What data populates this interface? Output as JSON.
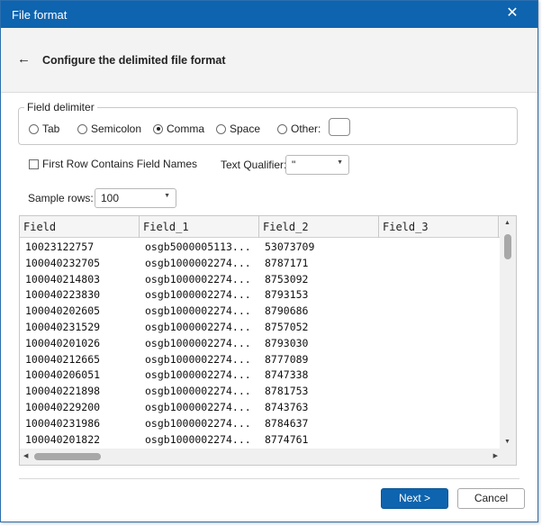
{
  "window": {
    "title": "File format"
  },
  "header": {
    "title": "Configure the delimited file format"
  },
  "delimiter": {
    "legend": "Field delimiter",
    "options": [
      {
        "label": "Tab",
        "checked": false
      },
      {
        "label": "Semicolon",
        "checked": false
      },
      {
        "label": "Comma",
        "checked": true
      },
      {
        "label": "Space",
        "checked": false
      },
      {
        "label": "Other:",
        "checked": false
      }
    ],
    "other_value": ""
  },
  "first_row": {
    "label": "First Row Contains Field Names",
    "checked": false
  },
  "text_qualifier": {
    "label": "Text Qualifier:",
    "value": "\""
  },
  "sample_rows": {
    "label": "Sample rows:",
    "value": "100"
  },
  "grid": {
    "columns": [
      "Field",
      "Field_1",
      "Field_2",
      "Field_3"
    ],
    "rows": [
      [
        "10023122757",
        "osgb5000005113...",
        "53073709",
        ""
      ],
      [
        "100040232705",
        "osgb1000002274...",
        "8787171",
        ""
      ],
      [
        "100040214803",
        "osgb1000002274...",
        "8753092",
        ""
      ],
      [
        "100040223830",
        "osgb1000002274...",
        "8793153",
        ""
      ],
      [
        "100040202605",
        "osgb1000002274...",
        "8790686",
        ""
      ],
      [
        "100040231529",
        "osgb1000002274...",
        "8757052",
        ""
      ],
      [
        "100040201026",
        "osgb1000002274...",
        "8793030",
        ""
      ],
      [
        "100040212665",
        "osgb1000002274...",
        "8777089",
        ""
      ],
      [
        "100040206051",
        "osgb1000002274...",
        "8747338",
        ""
      ],
      [
        "100040221898",
        "osgb1000002274...",
        "8781753",
        ""
      ],
      [
        "100040229200",
        "osgb1000002274...",
        "8743763",
        ""
      ],
      [
        "100040231986",
        "osgb1000002274...",
        "8784637",
        ""
      ],
      [
        "100040201822",
        "osgb1000002274...",
        "8774761",
        ""
      ]
    ]
  },
  "buttons": {
    "next": "Next >",
    "cancel": "Cancel"
  },
  "colors": {
    "accent": "#0e64ae"
  },
  "icons": {
    "close": "close-icon",
    "back": "back-arrow-icon"
  }
}
